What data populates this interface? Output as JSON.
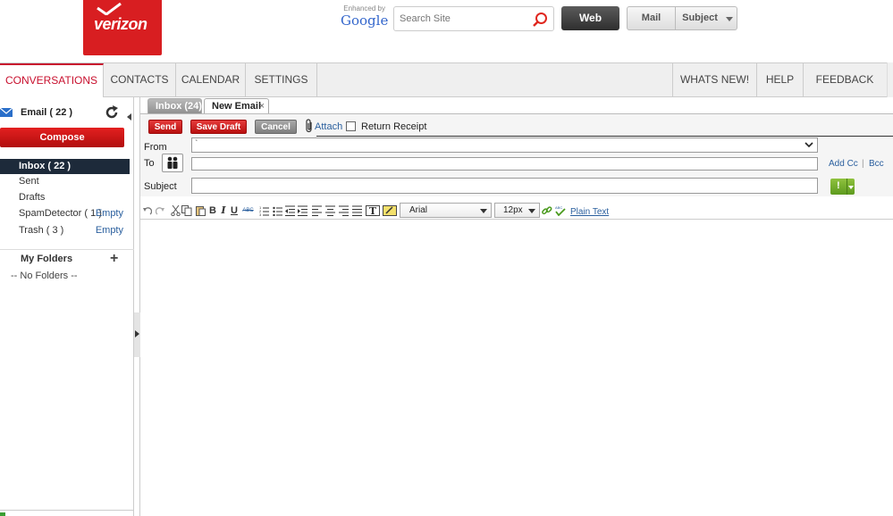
{
  "header": {
    "logo_text": "verizon",
    "search_enhanced_by": "Enhanced by",
    "search_provider": "Google",
    "search_placeholder": "Search Site",
    "web_button": "Web",
    "scope_mail": "Mail",
    "scope_subject": "Subject"
  },
  "nav": {
    "items": [
      {
        "label": "CONVERSATIONS",
        "active": true
      },
      {
        "label": "CONTACTS"
      },
      {
        "label": "CALENDAR"
      },
      {
        "label": "SETTINGS"
      }
    ],
    "right_items": [
      {
        "label": "WHATS NEW!"
      },
      {
        "label": "HELP"
      },
      {
        "label": "FEEDBACK"
      }
    ]
  },
  "sidebar": {
    "email_header": "Email ( 22 )",
    "compose": "Compose",
    "folders": [
      {
        "name": "Inbox ( 22 )",
        "selected": true,
        "empty": ""
      },
      {
        "name": "Sent",
        "empty": ""
      },
      {
        "name": "Drafts",
        "empty": ""
      },
      {
        "name": "SpamDetector ( 1 )",
        "empty": "Empty"
      },
      {
        "name": "Trash ( 3 )",
        "empty": "Empty"
      }
    ],
    "my_folders": "My Folders",
    "no_folders": "-- No Folders --"
  },
  "tabs": {
    "inbox": "Inbox (24)",
    "new_email": "New Email",
    "close_glyph": "×"
  },
  "compose": {
    "send": "Send",
    "save_draft": "Save Draft",
    "cancel": "Cancel",
    "attach": "Attach",
    "return_receipt": "Return Receipt",
    "from_label": "From",
    "from_value": "`",
    "to_label": "To",
    "to_value": "",
    "add_cc": "Add Cc",
    "cc_separator": "|",
    "bcc": "Bcc",
    "subject_label": "Subject",
    "subject_value": "",
    "priority_glyph": "!"
  },
  "formatting": {
    "font": "Arial",
    "size": "12px",
    "bold": "B",
    "italic": "I",
    "underline": "U",
    "strike": "ABC",
    "text_color": "T",
    "plain_text": "Plain Text"
  },
  "colors": {
    "brand_red": "#d81e21",
    "link_blue": "#2a5f9e",
    "selected_folder_bg": "#1d2a3a",
    "priority_green": "#6fa82a"
  }
}
